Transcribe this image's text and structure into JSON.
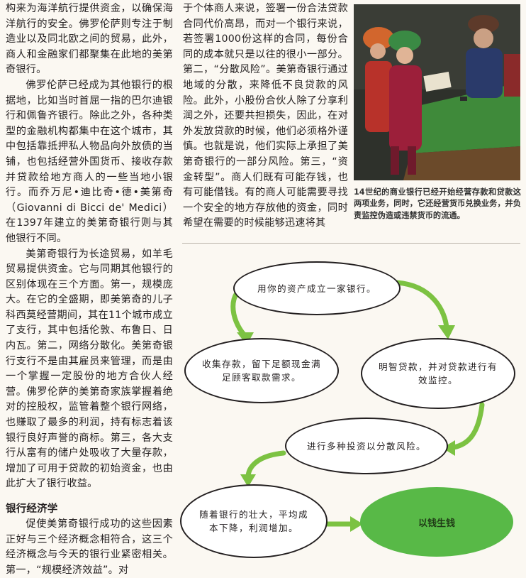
{
  "column1": {
    "p1": "构来为海洋航行提供资金，以确保海洋航行的安全。佛罗伦萨则专注于制造业以及同北欧之间的贸易，此外，商人和金融家们都聚集在此地的美第奇银行。",
    "p2": "佛罗伦萨已经成为其他银行的根据地，比如当时首屈一指的巴尔迪银行和佩鲁齐银行。除此之外，各种类型的金融机构都集中在这个城市，其中包括靠抵押私人物品向外放债的当铺，也包括经营外国货币、接收存款并贷款给地方商人的一些当地小银行。而乔万尼•迪比奇•德•美第奇（Giovanni di Bicci de' Medici）在1397年建立的美第奇银行则与其他银行不同。",
    "p3": "美第奇银行为长途贸易，如羊毛贸易提供资金。它与同期其他银行的区别体现在三个方面。第一，规模庞大。在它的全盛期，即美第奇的儿子科西莫经营期间，其在11个城市成立了支行，其中包括伦敦、布鲁日、日内瓦。第二，网络分散化。美第奇银行支行不是由其雇员来管理，而是由一个掌握一定股份的地方合伙人经营。佛罗伦萨的美第奇家族掌握着绝对的控股权，监管着整个银行网络，也赚取了最多的利润，持有标志着该银行良好声誉的商标。第三，各大支行从富有的储户处吸收了大量存款，增加了可用于贷款的初始资金，也由此扩大了银行收益。",
    "heading": "银行经济学",
    "p4": "促使美第奇银行成功的这些因素正好与三个经济概念相符合，这三个经济概念与今天的银行业紧密相关。第一，“规模经济效益”。对"
  },
  "column2": {
    "p1": "于个体商人来说，签署一份合法贷款合同代价高昂，而对一个银行来说，若签署1000份这样的合同，每份合同的成本就只是以往的很小一部分。第二，“分散风险”。美第奇银行通过地域的分散，来降低不良贷款的风险。此外，小股份合伙人除了分享利润之外，还要共担损失，因此，在对外发放贷款的时候，他们必须格外谨慎。也就是说，他们实际上承担了美第奇银行的一部分风险。第三，“资金转型”。商人们既有可能存钱，也有可能借钱。有的商人可能需要寻找一个安全的地方存放他的资金，同时希望在需要的时候能够迅速将其"
  },
  "photo": {
    "caption": "14世纪的商业银行已经开始经营存款和贷款这两项业务，同时，它还经营货币兑换业务，并负责监控伪造或违禁货币的流通。"
  },
  "diagram": {
    "top": "用你的资产成立一家银行。",
    "left": "收集存款，留下足额现金满足顾客取款需求。",
    "right": "明智贷款，并对贷款进行有效监控。",
    "middle": "进行多种投资以分散风险。",
    "bottom_left": "随着银行的壮大，平均成本下降，利润增加。",
    "result": "以钱生钱",
    "arrow_color": "#7cc242",
    "result_color": "#58b947"
  }
}
